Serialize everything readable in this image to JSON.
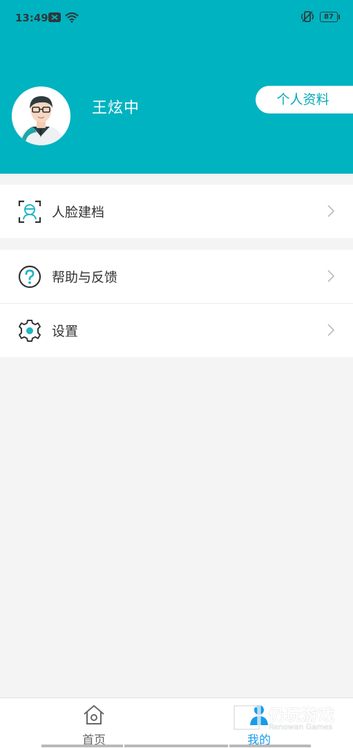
{
  "status_bar": {
    "time": "13:49",
    "battery": "87"
  },
  "header": {
    "user_name": "王炫中",
    "profile_button": "个人资料",
    "accent": "#00b3c1"
  },
  "menu_group_1": [
    {
      "label": "人脸建档",
      "icon": "face-scan-icon"
    }
  ],
  "menu_group_2": [
    {
      "label": "帮助与反馈",
      "icon": "help-icon"
    },
    {
      "label": "设置",
      "icon": "gear-icon"
    }
  ],
  "tabbar": {
    "home": {
      "label": "首页",
      "icon": "home-icon"
    },
    "mine": {
      "label": "我的",
      "icon": "person-icon",
      "active_color": "#1a9be8"
    }
  },
  "watermark": {
    "title": "仍玩游戏",
    "subtitle": "Renowan Games"
  }
}
